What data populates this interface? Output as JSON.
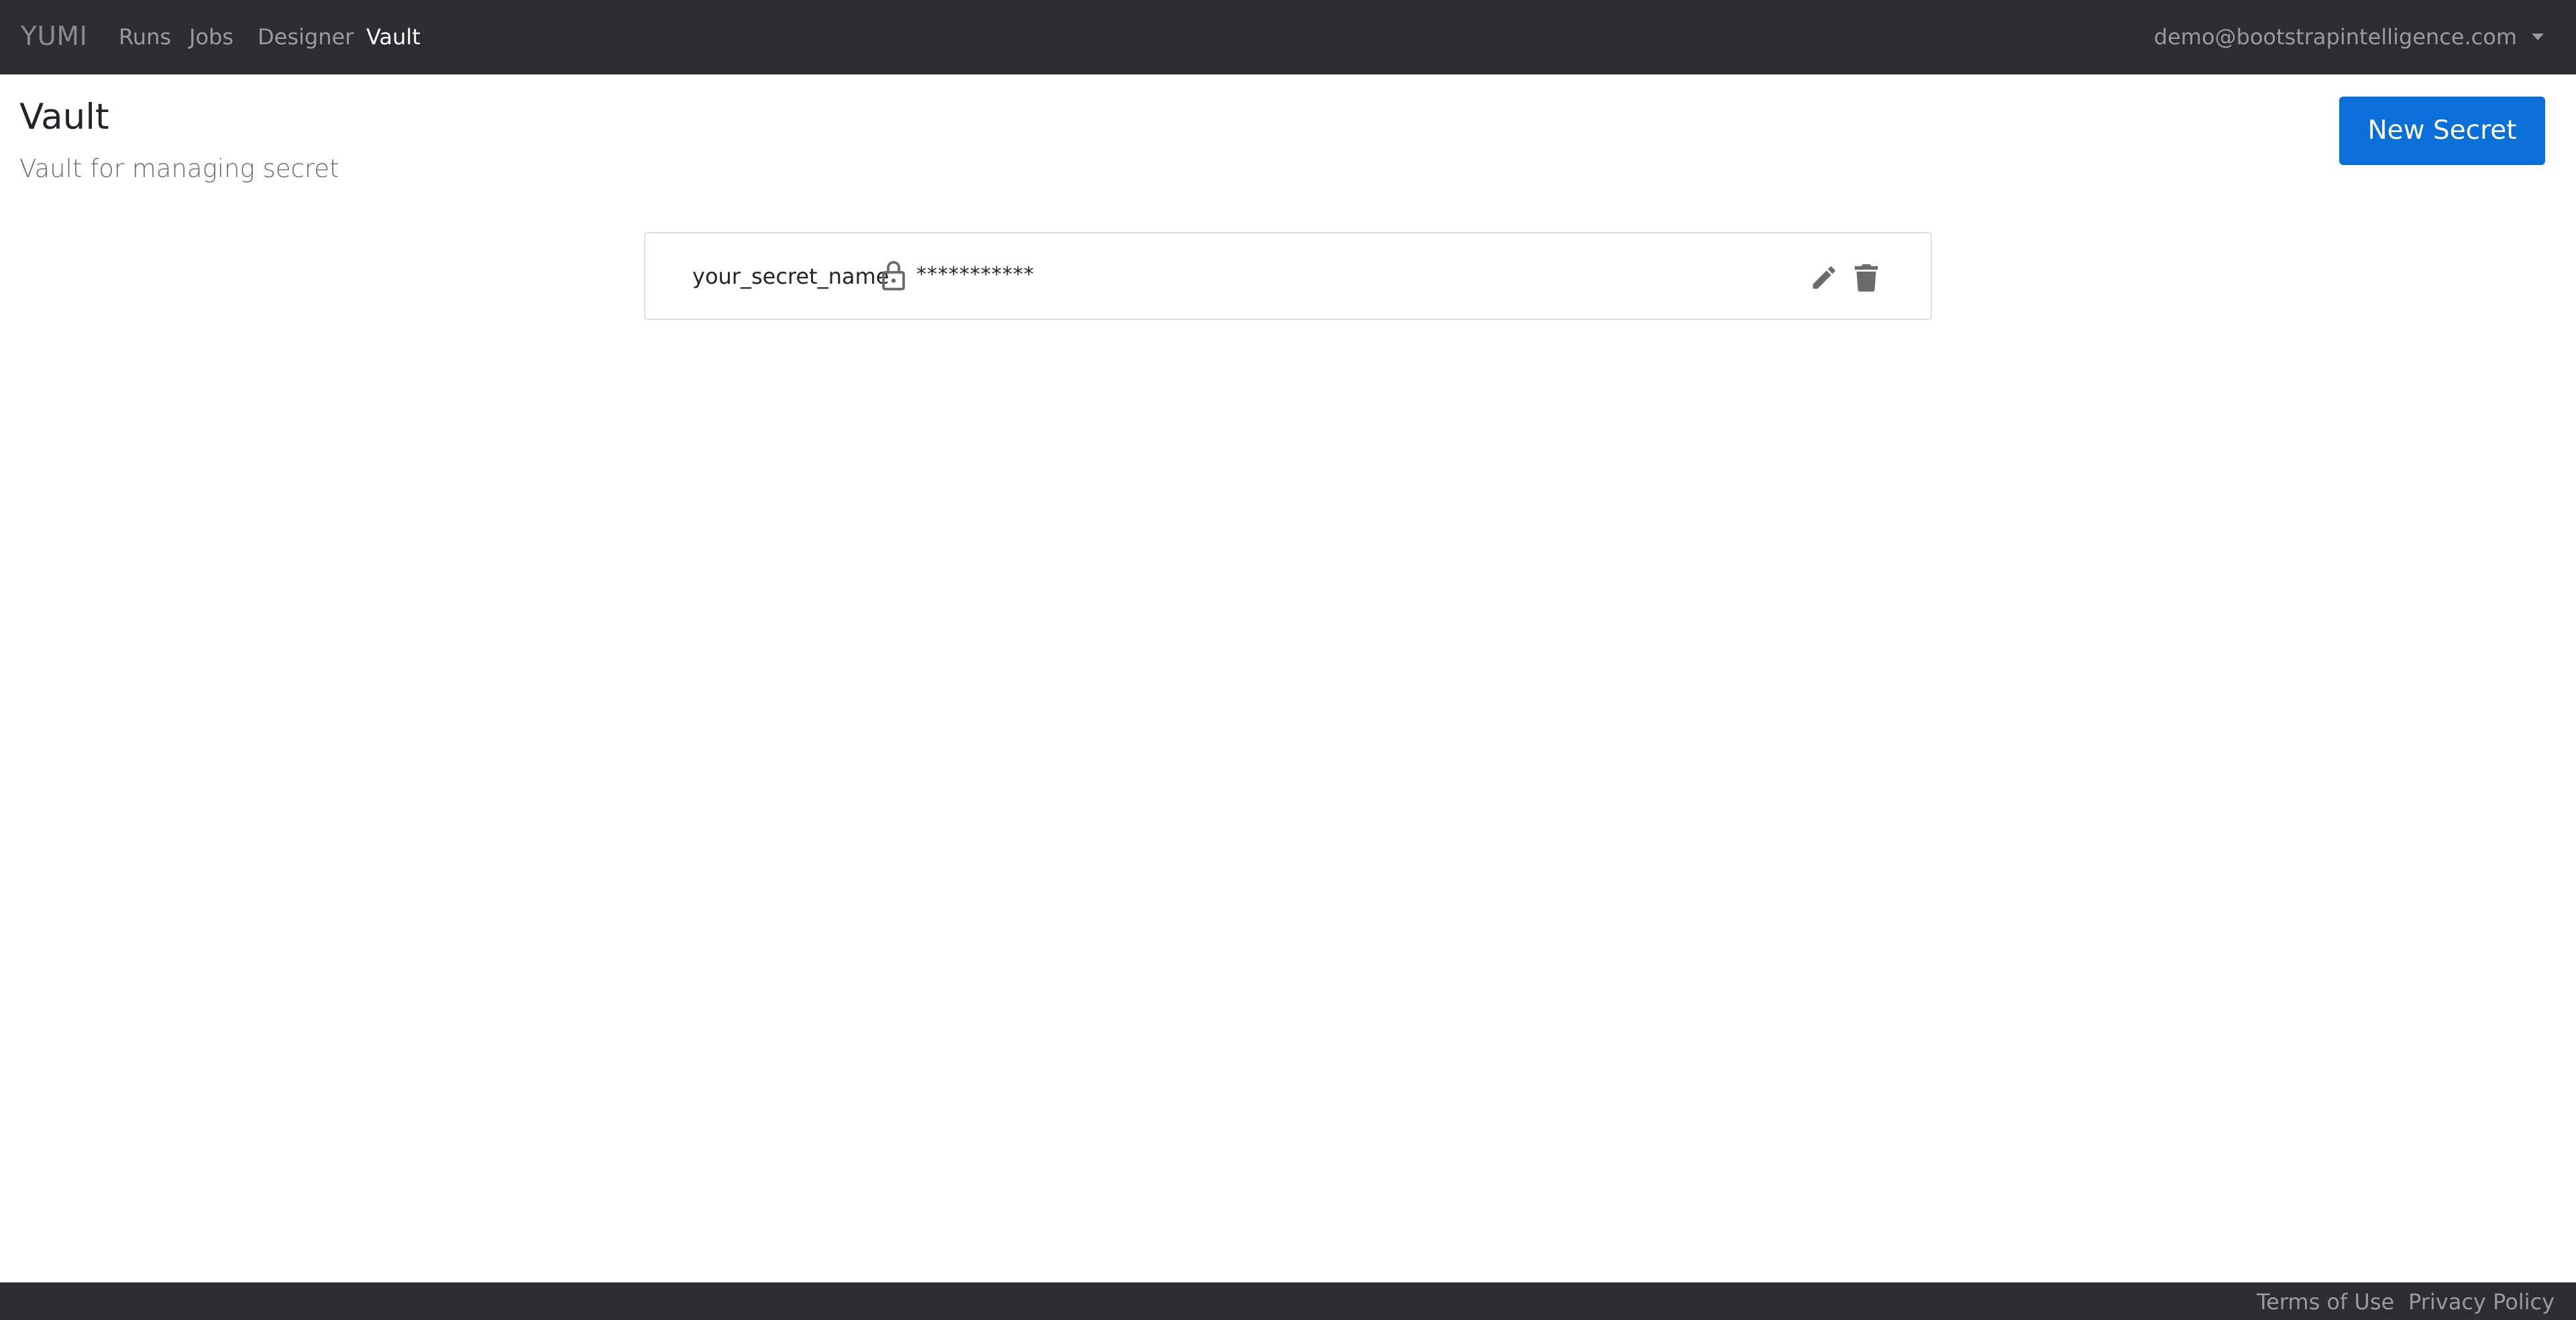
{
  "navbar": {
    "brand": "YUMI",
    "items": [
      {
        "label": "Runs",
        "active": false
      },
      {
        "label": "Jobs",
        "active": false
      },
      {
        "label": "Designer",
        "active": false
      },
      {
        "label": "Vault",
        "active": true
      }
    ],
    "user_email": "demo@bootstrapintelligence.com"
  },
  "page": {
    "title": "Vault",
    "subtitle": "Vault for managing secret",
    "new_button_label": "New Secret"
  },
  "secrets": [
    {
      "name": "your_secret_name",
      "masked_value": "***********",
      "icons": {
        "lock": "lock-icon",
        "edit": "edit-icon",
        "delete": "trash-icon"
      }
    }
  ],
  "footer": {
    "links": [
      "Terms of Use",
      "Privacy Policy"
    ]
  },
  "colors": {
    "navbar_bg": "#2c2d2f",
    "primary": "#0a6fd9",
    "nav_text": "#9a9b9d",
    "nav_active": "#ffffff",
    "icon": "#6b6b6b"
  }
}
